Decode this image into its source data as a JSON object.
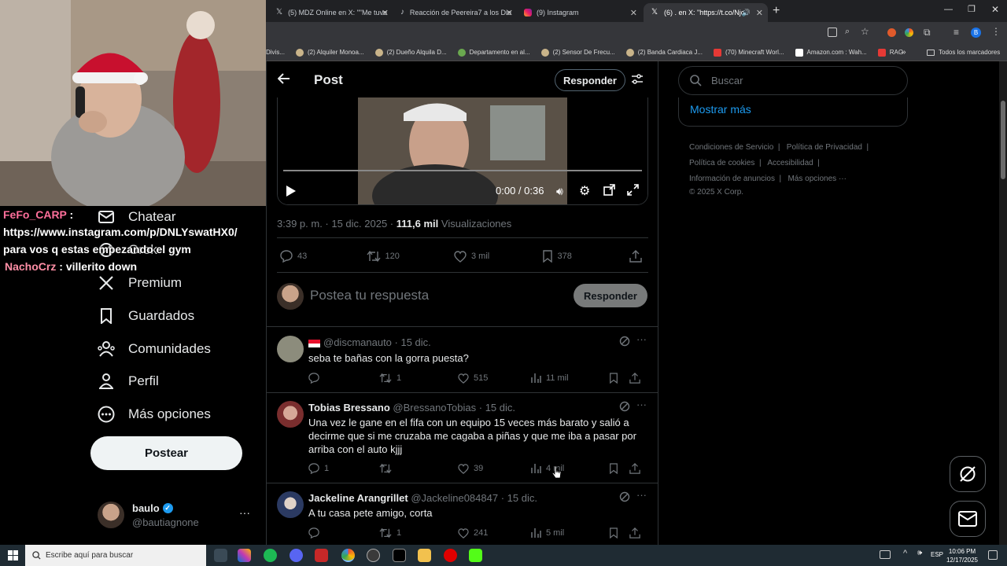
{
  "browser": {
    "tabs": [
      {
        "label": "(5) MDZ Online en X: \"\"Me tuve",
        "icon": "x-icon"
      },
      {
        "label": "Reacción de Peereira7 a los Die",
        "icon": "tiktok-icon"
      },
      {
        "label": "(9) Instagram",
        "icon": "instagram-icon"
      },
      {
        "label": "(6) . en X: \"https://t.co/Njo",
        "icon": "x-icon"
      }
    ],
    "bookmarks": [
      "Divis...",
      "(2) Alquiler Monoa...",
      "(2) Dueño Alquila D...",
      "Departamento en al...",
      "(2) Sensor De Frecu...",
      "(2) Banda Cardiaca J...",
      "(70) Minecraft Worl...",
      "Amazon.com : Wah...",
      "RAG"
    ],
    "bookmarks_folder": "Todos los marcadores"
  },
  "stream_chat": [
    {
      "user": "FeFo_CARP",
      "sep": " :",
      "text": "https://www.instagram.com/p/DNLYswatHX0/ para vos q estas empezando el gym"
    },
    {
      "user": "NachoCrz",
      "sep": " :",
      "text": "villerito down"
    }
  ],
  "nav": {
    "items": [
      {
        "label": "Chatear",
        "icon": "mail-icon"
      },
      {
        "label": "Grok",
        "icon": "grok-icon"
      },
      {
        "label": "Premium",
        "icon": "x-logo-icon"
      },
      {
        "label": "Guardados",
        "icon": "bookmark-icon"
      },
      {
        "label": "Comunidades",
        "icon": "people-icon"
      },
      {
        "label": "Perfil",
        "icon": "person-icon"
      },
      {
        "label": "Más opciones",
        "icon": "more-circle-icon"
      }
    ],
    "post_button": "Postear",
    "account": {
      "name": "baulo",
      "handle": "@bautiagnone"
    }
  },
  "post": {
    "header_title": "Post",
    "reply_button": "Responder",
    "video_time": "0:00 / 0:36",
    "timestamp": "3:39 p. m. · 15 dic. 2025 ·",
    "views_count": "111,6 mil",
    "views_label": "Visualizaciones",
    "replies": "43",
    "reposts": "120",
    "likes": "3 mil",
    "bookmarks": "378",
    "reply_placeholder": "Postea tu respuesta",
    "reply_submit": "Responder"
  },
  "replies": [
    {
      "name": "",
      "handle": "@discmanauto",
      "date": "· 15 dic.",
      "text": "seba te bañas con la gorra puesta?",
      "replies": "",
      "reposts": "1",
      "likes": "515",
      "views": "11 mil"
    },
    {
      "name": "Tobias Bressano",
      "handle": "@BressanoTobias",
      "date": "· 15 dic.",
      "text": "Una vez le gane en el fifa con un equipo 15 veces más barato y salió a decirme que si me cruzaba me cagaba a piñas y que me iba a pasar por arriba con el auto kjjj",
      "replies": "1",
      "reposts": "",
      "likes": "39",
      "views": "4 mil"
    },
    {
      "name": "Jackeline Arangrillet",
      "handle": "@Jackeline084847",
      "date": "· 15 dic.",
      "text": "A tu casa pete amigo, corta",
      "replies": "",
      "reposts": "1",
      "likes": "241",
      "views": "5 mil"
    }
  ],
  "sidebar": {
    "search_placeholder": "Buscar",
    "show_more": "Mostrar más",
    "footer_links": [
      "Condiciones de Servicio",
      "Política de Privacidad",
      "Política de cookies",
      "Accesibilidad",
      "Información de anuncios",
      "Más opciones ···"
    ],
    "copyright": "© 2025 X Corp."
  },
  "taskbar": {
    "search_placeholder": "Escribe aquí para buscar",
    "lang": "ESP",
    "time": "10:06 PM",
    "date": "12/17/2025"
  },
  "colors": {
    "accent": "#1d9bf0",
    "link": "#1d9bf0",
    "chat_user": "#ff6f9b"
  }
}
